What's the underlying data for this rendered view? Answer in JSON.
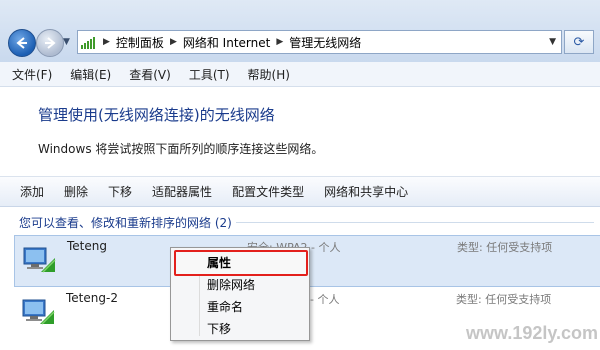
{
  "address": {
    "crumbs": [
      "控制面板",
      "网络和 Internet",
      "管理无线网络"
    ]
  },
  "menu": [
    "文件(F)",
    "编辑(E)",
    "查看(V)",
    "工具(T)",
    "帮助(H)"
  ],
  "header": {
    "title": "管理使用(无线网络连接)的无线网络",
    "description": "Windows 将尝试按照下面所列的顺序连接这些网络。"
  },
  "commands": [
    "添加",
    "删除",
    "下移",
    "适配器属性",
    "配置文件类型",
    "网络和共享中心"
  ],
  "group_header": "您可以查看、修改和重新排序的网络 (2)",
  "networks": [
    {
      "name": "Teteng",
      "security": "安全: WPA2 - 个人",
      "type": "类型: 任何受支持项"
    },
    {
      "name": "Teteng-2",
      "security": "安全: WPA2 - 个人",
      "type": "类型: 任何受支持项"
    }
  ],
  "context_menu": [
    "属性",
    "删除网络",
    "重命名",
    "下移"
  ],
  "watermark": "www.192ly.com",
  "colors": {
    "highlight_border": "#e3201c",
    "title_blue": "#1a3b8c"
  }
}
